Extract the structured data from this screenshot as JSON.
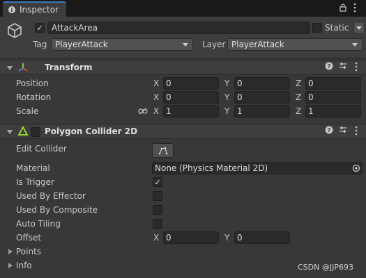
{
  "tab": {
    "title": "Inspector",
    "info_icon": "info-icon",
    "lock_icon": "lock-icon",
    "menu_icon": "kebab-menu-icon"
  },
  "gameobject": {
    "active": true,
    "name": "AttackArea",
    "static_label": "Static",
    "static_checked": false,
    "tag_label": "Tag",
    "tag_value": "PlayerAttack",
    "layer_label": "Layer",
    "layer_value": "PlayerAttack"
  },
  "transform": {
    "title": "Transform",
    "position": {
      "label": "Position",
      "x": "0",
      "y": "0",
      "z": "0"
    },
    "rotation": {
      "label": "Rotation",
      "x": "0",
      "y": "0",
      "z": "0"
    },
    "scale": {
      "label": "Scale",
      "x": "1",
      "y": "1",
      "z": "1"
    },
    "axis": {
      "x": "X",
      "y": "Y",
      "z": "Z"
    }
  },
  "collider": {
    "title": "Polygon Collider 2D",
    "enabled": false,
    "edit_collider_label": "Edit Collider",
    "material_label": "Material",
    "material_value": "None (Physics Material 2D)",
    "is_trigger_label": "Is Trigger",
    "is_trigger": true,
    "used_by_effector_label": "Used By Effector",
    "used_by_effector": false,
    "used_by_composite_label": "Used By Composite",
    "used_by_composite": false,
    "auto_tiling_label": "Auto Tiling",
    "auto_tiling": false,
    "offset_label": "Offset",
    "offset_x": "0",
    "offset_y": "0",
    "points_label": "Points",
    "info_label": "Info"
  },
  "watermark": "CSDN @JJP693",
  "check_glyph": "✓",
  "colors": {
    "tab_accent": "#3a79bb",
    "background": "#383838",
    "collider_icon": "#a6e22e"
  }
}
